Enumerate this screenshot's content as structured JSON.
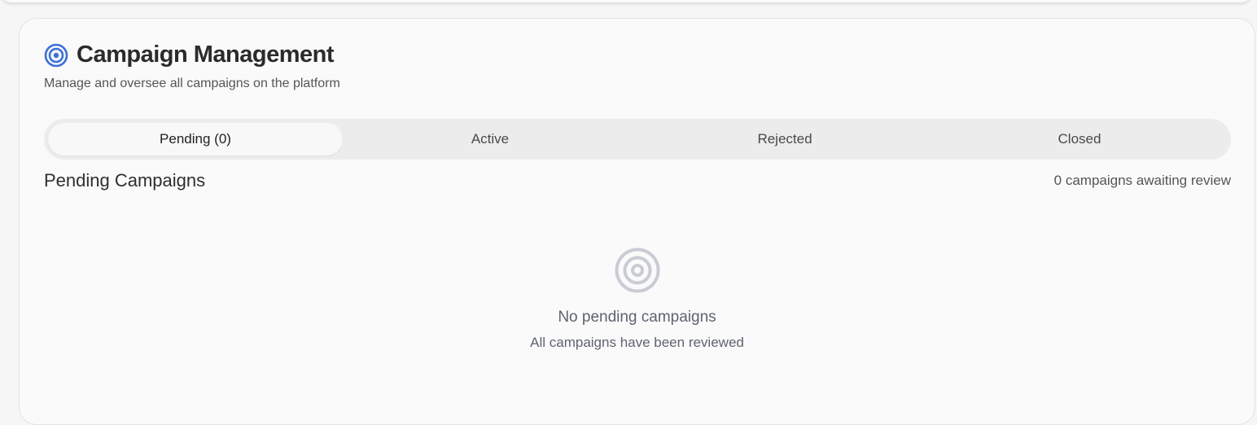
{
  "header": {
    "title": "Campaign Management",
    "subtitle": "Manage and oversee all campaigns on the platform",
    "icon": "target-icon",
    "accent_color": "#3c6fd8"
  },
  "tabs": [
    {
      "label": "Pending (0)",
      "selected": true
    },
    {
      "label": "Active",
      "selected": false
    },
    {
      "label": "Rejected",
      "selected": false
    },
    {
      "label": "Closed",
      "selected": false
    }
  ],
  "section": {
    "title": "Pending Campaigns",
    "count_text": "0 campaigns awaiting review"
  },
  "empty_state": {
    "icon": "target-icon",
    "icon_color": "#c9ccd3",
    "title": "No pending campaigns",
    "subtitle": "All campaigns have been reviewed"
  }
}
